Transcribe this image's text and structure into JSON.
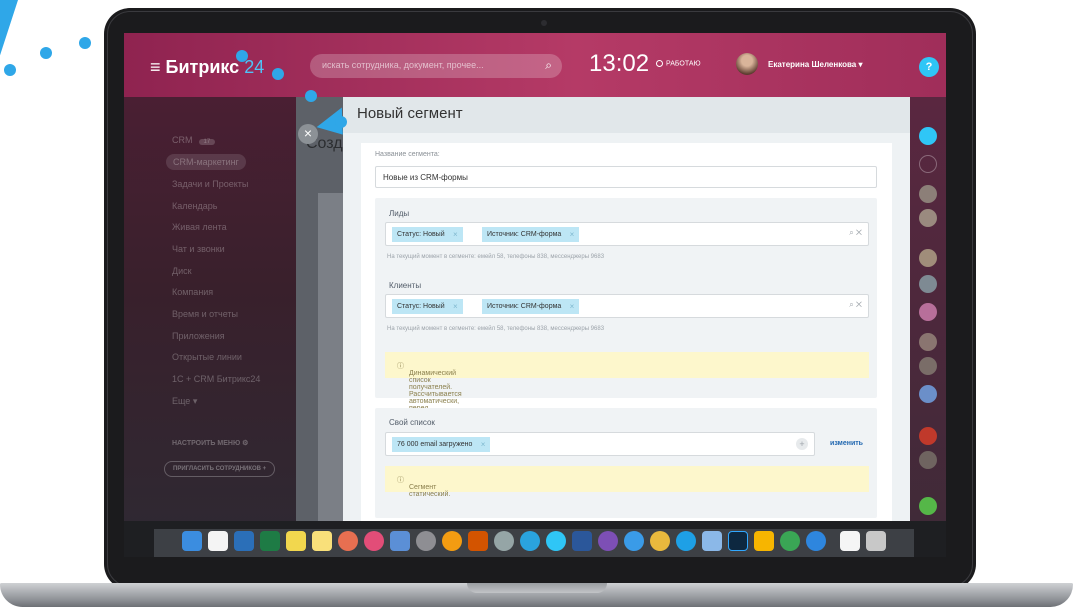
{
  "header": {
    "logo_text": "Битрикс",
    "logo_number": "24",
    "search_placeholder": "искать сотрудника, документ, прочее...",
    "time": "13:02",
    "work_status": "РАБОТАЮ",
    "user_name": "Екатерина Шеленкова",
    "help_label": "?"
  },
  "sidebar": {
    "items": [
      {
        "label": "CRM",
        "badge": "17"
      },
      {
        "label": "CRM-маркетинг"
      },
      {
        "label": "Задачи и Проекты"
      },
      {
        "label": "Календарь"
      },
      {
        "label": "Живая лента"
      },
      {
        "label": "Чат и звонки"
      },
      {
        "label": "Диск"
      },
      {
        "label": "Компания"
      },
      {
        "label": "Время и отчеты"
      },
      {
        "label": "Приложения"
      },
      {
        "label": "Открытые линии"
      },
      {
        "label": "1С + CRM Битрикс24"
      },
      {
        "label": "Еще"
      }
    ],
    "settings": "НАСТРОИТЬ МЕНЮ",
    "invite": "ПРИГЛАСИТЬ СОТРУДНИКОВ"
  },
  "background_page": {
    "title": "Созд"
  },
  "panel": {
    "title": "Новый сегмент",
    "name_label": "Название сегмента:",
    "name_value": "Новые из CRM-формы",
    "leads": {
      "title": "Лиды",
      "tags": [
        "Статус: Новый",
        "Источник: CRM-форма"
      ],
      "hint": "На текущий момент в сегменте: емейл 58, телефоны 838, мессенджеры 9683"
    },
    "clients": {
      "title": "Клиенты",
      "tags": [
        "Статус: Новый",
        "Источник: CRM-форма"
      ],
      "hint": "На текущий момент в сегменте: емейл 58, телефоны 838, мессенджеры 9683"
    },
    "dynamic_note": "Динамический список получателей. Рассчитывается автоматически, перед запуском.",
    "own_list": {
      "title": "Свой список",
      "tag": "76 000 email загружено",
      "change_label": "изменить",
      "note": "Сегмент статический."
    }
  },
  "colors": {
    "accent": "#2fa7e8",
    "header_brand": "#b53a66",
    "tag_bg": "#bde6f5",
    "note_bg": "#fdf7cc"
  }
}
